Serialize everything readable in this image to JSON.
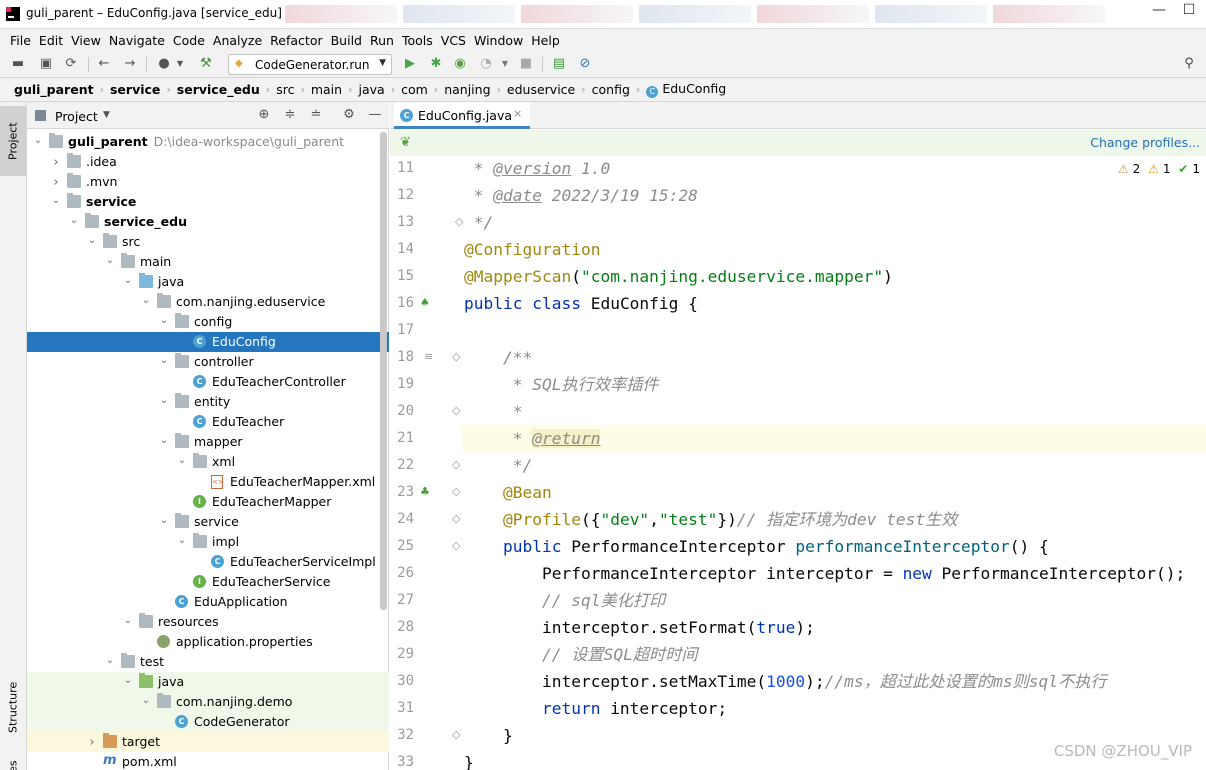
{
  "window": {
    "title": "guli_parent – EduConfig.java [service_edu]"
  },
  "menu": [
    "File",
    "Edit",
    "View",
    "Navigate",
    "Code",
    "Analyze",
    "Refactor",
    "Build",
    "Run",
    "Tools",
    "VCS",
    "Window",
    "Help"
  ],
  "toolbar": {
    "run_config": "CodeGenerator.run"
  },
  "breadcrumb": [
    {
      "label": "guli_parent",
      "bold": true
    },
    {
      "label": "service",
      "bold": true
    },
    {
      "label": "service_edu",
      "bold": true
    },
    {
      "label": "src",
      "bold": false
    },
    {
      "label": "main",
      "bold": false
    },
    {
      "label": "java",
      "bold": false
    },
    {
      "label": "com",
      "bold": false
    },
    {
      "label": "nanjing",
      "bold": false
    },
    {
      "label": "eduservice",
      "bold": false
    },
    {
      "label": "config",
      "bold": false
    },
    {
      "label": "EduConfig",
      "bold": false,
      "icon": "class-icon"
    }
  ],
  "side_tabs": {
    "project": "Project",
    "structure": "Structure",
    "bottom": "es"
  },
  "project_panel": {
    "title": "Project"
  },
  "tree": [
    {
      "label": "guli_parent",
      "extra": "D:\\idea-workspace\\guli_parent",
      "depth": 0,
      "arrow": "open",
      "icon": "folder",
      "bold": true
    },
    {
      "label": ".idea",
      "depth": 1,
      "arrow": "closed",
      "icon": "folder"
    },
    {
      "label": ".mvn",
      "depth": 1,
      "arrow": "closed",
      "icon": "folder"
    },
    {
      "label": "service",
      "depth": 1,
      "arrow": "open",
      "icon": "folder",
      "bold": true
    },
    {
      "label": "service_edu",
      "depth": 2,
      "arrow": "open",
      "icon": "folder",
      "bold": true
    },
    {
      "label": "src",
      "depth": 3,
      "arrow": "open",
      "icon": "folder"
    },
    {
      "label": "main",
      "depth": 4,
      "arrow": "open",
      "icon": "folder"
    },
    {
      "label": "java",
      "depth": 5,
      "arrow": "open",
      "icon": "folder-blue"
    },
    {
      "label": "com.nanjing.eduservice",
      "depth": 6,
      "arrow": "open",
      "icon": "folder"
    },
    {
      "label": "config",
      "depth": 7,
      "arrow": "open",
      "icon": "folder"
    },
    {
      "label": "EduConfig",
      "depth": 8,
      "arrow": "none",
      "icon": "class",
      "selected": true
    },
    {
      "label": "controller",
      "depth": 7,
      "arrow": "open",
      "icon": "folder"
    },
    {
      "label": "EduTeacherController",
      "depth": 8,
      "arrow": "none",
      "icon": "class"
    },
    {
      "label": "entity",
      "depth": 7,
      "arrow": "open",
      "icon": "folder"
    },
    {
      "label": "EduTeacher",
      "depth": 8,
      "arrow": "none",
      "icon": "class"
    },
    {
      "label": "mapper",
      "depth": 7,
      "arrow": "open",
      "icon": "folder"
    },
    {
      "label": "xml",
      "depth": 8,
      "arrow": "open",
      "icon": "folder"
    },
    {
      "label": "EduTeacherMapper.xml",
      "depth": 9,
      "arrow": "none",
      "icon": "xml"
    },
    {
      "label": "EduTeacherMapper",
      "depth": 8,
      "arrow": "none",
      "icon": "interface"
    },
    {
      "label": "service",
      "depth": 7,
      "arrow": "open",
      "icon": "folder"
    },
    {
      "label": "impl",
      "depth": 8,
      "arrow": "open",
      "icon": "folder"
    },
    {
      "label": "EduTeacherServiceImpl",
      "depth": 9,
      "arrow": "none",
      "icon": "class"
    },
    {
      "label": "EduTeacherService",
      "depth": 8,
      "arrow": "none",
      "icon": "interface"
    },
    {
      "label": "EduApplication",
      "depth": 7,
      "arrow": "none",
      "icon": "class"
    },
    {
      "label": "resources",
      "depth": 5,
      "arrow": "open",
      "icon": "folder-res"
    },
    {
      "label": "application.properties",
      "depth": 6,
      "arrow": "none",
      "icon": "props"
    },
    {
      "label": "test",
      "depth": 4,
      "arrow": "open",
      "icon": "folder"
    },
    {
      "label": "java",
      "depth": 5,
      "arrow": "open",
      "icon": "folder-green",
      "bg": "test"
    },
    {
      "label": "com.nanjing.demo",
      "depth": 6,
      "arrow": "open",
      "icon": "folder",
      "bg": "test"
    },
    {
      "label": "CodeGenerator",
      "depth": 7,
      "arrow": "none",
      "icon": "class",
      "bg": "test"
    },
    {
      "label": "target",
      "depth": 3,
      "arrow": "closed",
      "icon": "folder-orange",
      "bg": "target"
    },
    {
      "label": "pom.xml",
      "depth": 3,
      "arrow": "none",
      "icon": "maven"
    }
  ],
  "editor": {
    "tab_label": "EduConfig.java",
    "tab_close": "×",
    "change_profiles": "Change profiles...",
    "inspections": {
      "weak_warnings": "2",
      "warnings": "1",
      "ok": "1"
    },
    "current_line": 21,
    "lines": [
      {
        "n": "11",
        "tokens": [
          [
            "cmt",
            " * "
          ],
          [
            "doctag",
            "@version"
          ],
          [
            "cmt",
            " 1.0"
          ]
        ]
      },
      {
        "n": "12",
        "tokens": [
          [
            "cmt",
            " * "
          ],
          [
            "doctag",
            "@date"
          ],
          [
            "cmt",
            " 2022/3/19 15:28"
          ]
        ]
      },
      {
        "n": "13",
        "tokens": [
          [
            "cmt",
            " */"
          ]
        ]
      },
      {
        "n": "14",
        "tokens": [
          [
            "an",
            "@Configuration"
          ]
        ]
      },
      {
        "n": "15",
        "tokens": [
          [
            "an",
            "@MapperScan"
          ],
          [
            "plain",
            "("
          ],
          [
            "str",
            "\"com.nanjing.eduservice.mapper\""
          ],
          [
            "plain",
            ")"
          ]
        ]
      },
      {
        "n": "16",
        "tokens": [
          [
            "kw",
            "public class "
          ],
          [
            "plain",
            "EduConfig {"
          ]
        ]
      },
      {
        "n": "17",
        "tokens": []
      },
      {
        "n": "18",
        "tokens": [
          [
            "cmt",
            "    /**"
          ]
        ]
      },
      {
        "n": "19",
        "tokens": [
          [
            "cmt",
            "     * SQL执行效率插件"
          ]
        ]
      },
      {
        "n": "20",
        "tokens": [
          [
            "cmt",
            "     *"
          ]
        ]
      },
      {
        "n": "21",
        "tokens": [
          [
            "cmt",
            "     * "
          ],
          [
            "doctag-hl",
            "@return"
          ]
        ]
      },
      {
        "n": "22",
        "tokens": [
          [
            "cmt",
            "     */"
          ]
        ]
      },
      {
        "n": "23",
        "tokens": [
          [
            "an",
            "    @Bean"
          ]
        ]
      },
      {
        "n": "24",
        "tokens": [
          [
            "an",
            "    @Profile"
          ],
          [
            "plain",
            "({"
          ],
          [
            "str",
            "\"dev\""
          ],
          [
            "plain",
            ","
          ],
          [
            "str",
            "\"test\""
          ],
          [
            "plain",
            "})"
          ],
          [
            "cmt",
            "// 指定环境为dev test生效"
          ]
        ]
      },
      {
        "n": "25",
        "tokens": [
          [
            "kw",
            "    public "
          ],
          [
            "plain",
            "PerformanceInterceptor "
          ],
          [
            "fn",
            "performanceInterceptor"
          ],
          [
            "plain",
            "() {"
          ]
        ]
      },
      {
        "n": "26",
        "tokens": [
          [
            "plain",
            "        PerformanceInterceptor interceptor = "
          ],
          [
            "kw",
            "new "
          ],
          [
            "plain",
            "PerformanceInterceptor();"
          ]
        ]
      },
      {
        "n": "27",
        "tokens": [
          [
            "cmt",
            "        // sql美化打印"
          ]
        ]
      },
      {
        "n": "28",
        "tokens": [
          [
            "plain",
            "        interceptor.setFormat("
          ],
          [
            "kw",
            "true"
          ],
          [
            "plain",
            ");"
          ]
        ]
      },
      {
        "n": "29",
        "tokens": [
          [
            "cmt",
            "        // 设置SQL超时时间"
          ]
        ]
      },
      {
        "n": "30",
        "tokens": [
          [
            "plain",
            "        interceptor.setMaxTime("
          ],
          [
            "num",
            "1000"
          ],
          [
            "plain",
            ");"
          ],
          [
            "cmt",
            "//ms，超过此处设置的ms则sql不执行"
          ]
        ]
      },
      {
        "n": "31",
        "tokens": [
          [
            "kw",
            "        return "
          ],
          [
            "plain",
            "interceptor;"
          ]
        ]
      },
      {
        "n": "32",
        "tokens": [
          [
            "plain",
            "    }"
          ]
        ]
      },
      {
        "n": "33",
        "tokens": [
          [
            "plain",
            "}"
          ]
        ]
      }
    ]
  },
  "watermark": "CSDN @ZHOU_VIP"
}
